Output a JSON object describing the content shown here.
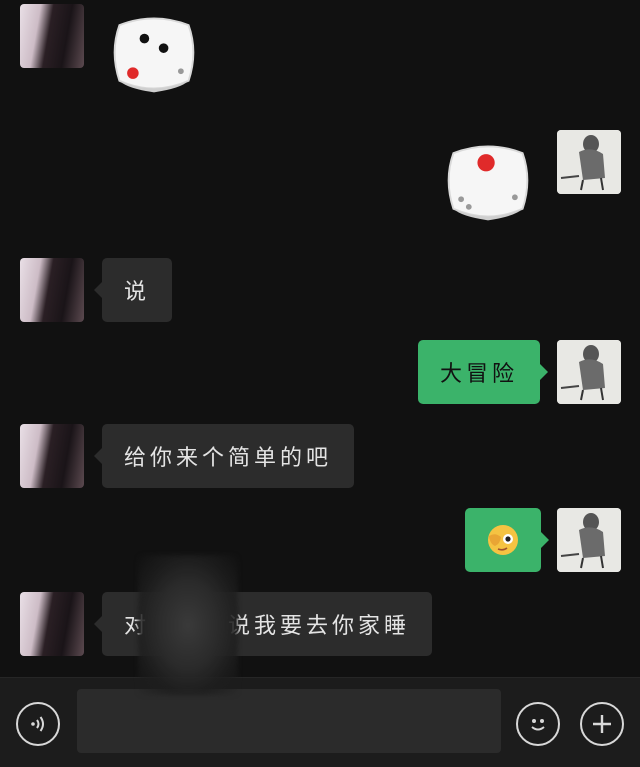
{
  "messages": [
    {
      "side": "left",
      "type": "dice",
      "dice_value": 2
    },
    {
      "side": "right",
      "type": "dice",
      "dice_value": 1
    },
    {
      "side": "left",
      "type": "text",
      "text": "说"
    },
    {
      "side": "right",
      "type": "text",
      "text": "大冒险"
    },
    {
      "side": "left",
      "type": "text",
      "text": "给你来个简单的吧"
    },
    {
      "side": "right",
      "type": "emoji",
      "emoji": "face-with-hand-over-eye"
    },
    {
      "side": "left",
      "type": "text",
      "text_before": "对",
      "text_after": "说我要去你家睡",
      "redacted": true
    }
  ],
  "colors": {
    "background": "#111111",
    "incoming_bubble": "#2c2c2c",
    "outgoing_bubble": "#3bb36a",
    "dice_pip_red": "#e02a2a"
  },
  "input_bar": {
    "voice_icon": "voice-icon",
    "emoji_icon": "emoji-icon",
    "add_icon": "plus-icon",
    "text_value": ""
  }
}
